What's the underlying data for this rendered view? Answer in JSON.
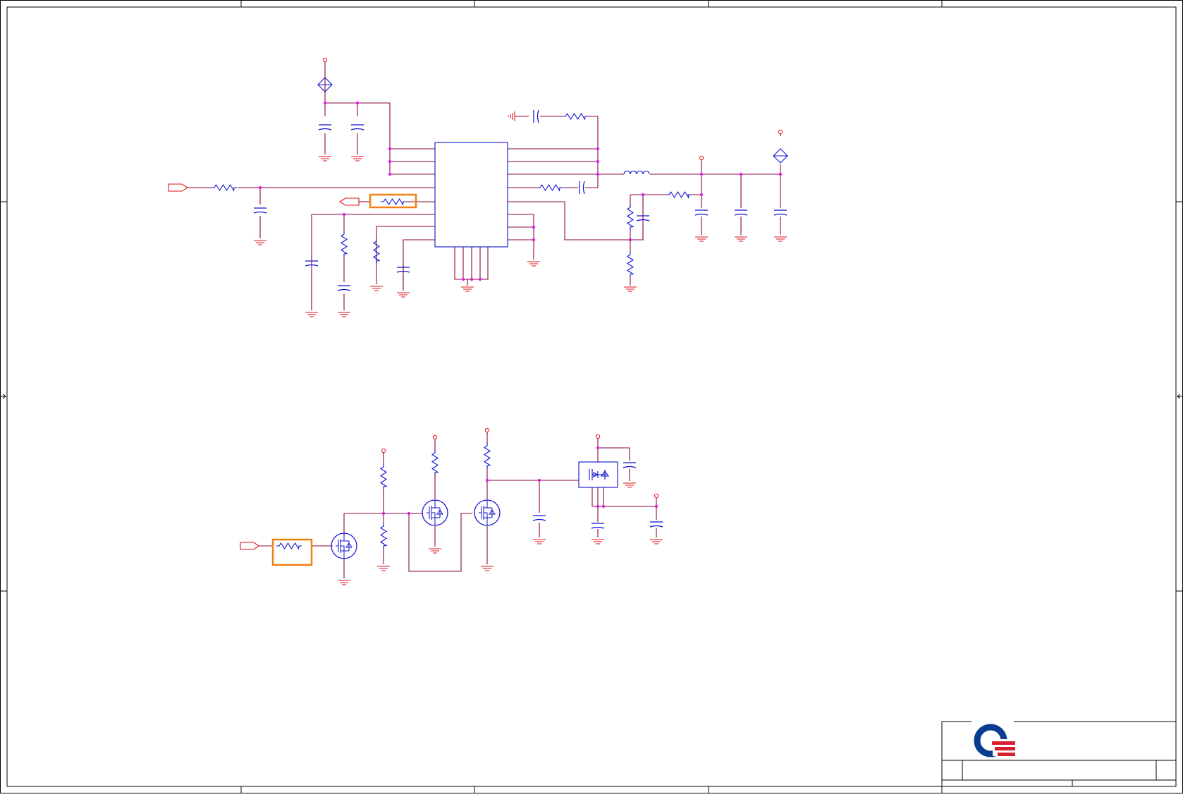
{
  "colors": {
    "frame": "#000000",
    "wire": "#8b0a3c",
    "component": "#1010d0",
    "power": "#e0101a",
    "junction": "#e020e0",
    "highlight": "#f08010",
    "logo_blue": "#0a3d8f",
    "logo_red": "#d62030"
  },
  "icons": {
    "logo": "company-logo-icon",
    "mosfet": "mosfet-icon",
    "resistor": "resistor-icon",
    "capacitor": "capacitor-icon",
    "inductor": "inductor-icon",
    "ground": "ground-icon",
    "power_pin": "power-pin-icon",
    "port": "off-page-connector-icon"
  },
  "title_block": {
    "title": "",
    "sheet": ""
  }
}
